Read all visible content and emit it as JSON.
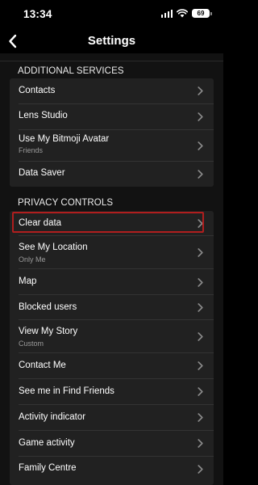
{
  "status_bar": {
    "time": "13:34",
    "battery": "69",
    "icons": [
      "signal-icon",
      "wifi-icon",
      "battery-icon"
    ]
  },
  "header": {
    "title": "Settings",
    "back_icon": "chevron-left-icon"
  },
  "sections": [
    {
      "title": "ADDITIONAL SERVICES",
      "items": [
        {
          "label": "Contacts",
          "sub": ""
        },
        {
          "label": "Lens Studio",
          "sub": ""
        },
        {
          "label": "Use My Bitmoji Avatar",
          "sub": "Friends"
        },
        {
          "label": "Data Saver",
          "sub": ""
        }
      ]
    },
    {
      "title": "PRIVACY CONTROLS",
      "items": [
        {
          "label": "Clear data",
          "sub": ""
        },
        {
          "label": "See My Location",
          "sub": "Only Me"
        },
        {
          "label": "Map",
          "sub": ""
        },
        {
          "label": "Blocked users",
          "sub": ""
        },
        {
          "label": "View My Story",
          "sub": "Custom"
        },
        {
          "label": "Contact Me",
          "sub": ""
        },
        {
          "label": "See me in Find Friends",
          "sub": ""
        },
        {
          "label": "Activity indicator",
          "sub": ""
        },
        {
          "label": "Game activity",
          "sub": ""
        },
        {
          "label": "Family Centre",
          "sub": ""
        }
      ]
    }
  ],
  "colors": {
    "background": "#121212",
    "card": "#212121",
    "highlight": "#b01e1e",
    "secondary_text": "#9a9a9a"
  }
}
